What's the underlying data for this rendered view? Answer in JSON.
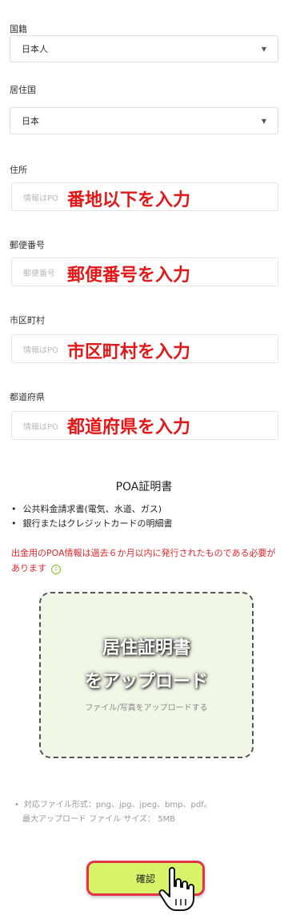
{
  "nationality": {
    "label": "国籍",
    "value": "日本人"
  },
  "residence_country": {
    "label": "居住国",
    "value": "日本"
  },
  "address": {
    "label": "住所",
    "placeholder": "情報はPO",
    "overlay": "番地以下を入力"
  },
  "postal_code": {
    "label": "郵便番号",
    "placeholder": "郵便番号",
    "overlay": "郵便番号を入力"
  },
  "city": {
    "label": "市区町村",
    "placeholder": "情報はPO",
    "overlay": "市区町村を入力"
  },
  "prefecture": {
    "label": "都道府県",
    "placeholder": "情報はPO",
    "overlay": "都道府県を入力"
  },
  "poa": {
    "title": "POA証明書",
    "items": [
      "公共料金請求書(電気、水道、ガス)",
      "銀行またはクレジットカードの明細書"
    ],
    "warning": "出金用のPOA情報は過去６か月以内に発行されたものである必要があります",
    "upload_text": "ファイル/写真をアップロードする",
    "upload_overlay_1": "居住証明書",
    "upload_overlay_2": "をアップロード",
    "formats": "対応ファイル形式：png、jpg、jpeg、bmp、pdf。",
    "max_size": "最大アップロード ファイル サイズ： 5MB"
  },
  "confirm_label": "確認",
  "colors": {
    "accent_green": "#d8f56a",
    "warning_red": "#e0282c",
    "highlight_border": "#e4344a"
  }
}
